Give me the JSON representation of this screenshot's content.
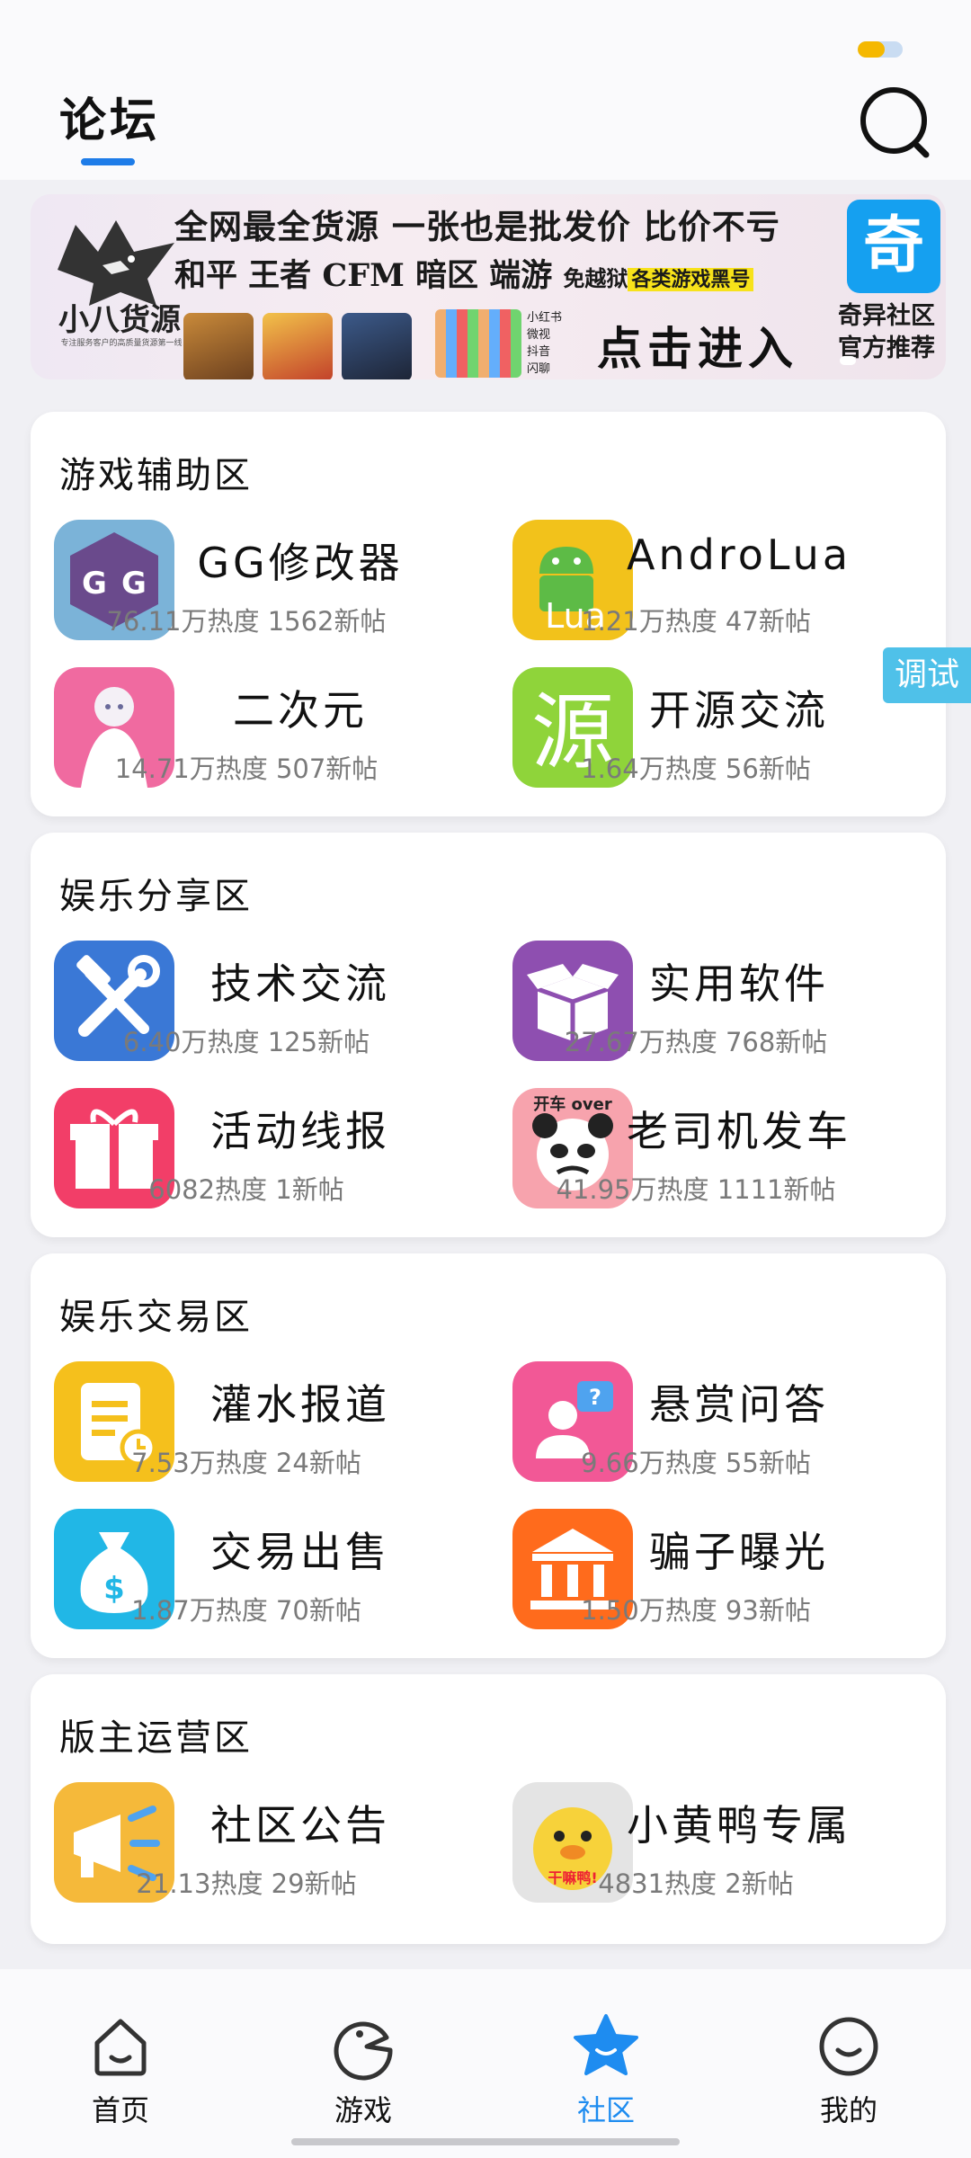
{
  "header": {
    "title": "论坛"
  },
  "status": {
    "battery_level": 0.6
  },
  "banner": {
    "shop_name": "小八货源",
    "shop_sub": "专注服务客户的高质量货源第一线",
    "line1": "全网最全货源 一张也是批发价 比价不亏",
    "line2": "和平 王者 CFM 暗区 端游",
    "line2_small": "免越狱",
    "highlight": "各类游戏黑号",
    "mini_list": [
      "小红书",
      "微视",
      "抖音",
      "闪聊"
    ],
    "enter": "点击进入",
    "badge": "奇",
    "recommend": [
      "奇异社区",
      "官方推荐"
    ]
  },
  "debug_tab": "调试",
  "sections": [
    {
      "title": "游戏辅助区",
      "items": [
        {
          "name": "GG修改器",
          "stats": "76.11万热度 1562新帖",
          "icon": "gg-modifier-icon"
        },
        {
          "name": "AndroLua",
          "stats": "1.21万热度 47新帖",
          "icon": "androlua-icon"
        },
        {
          "name": "二次元",
          "stats": "14.71万热度 507新帖",
          "icon": "anime-girl-icon"
        },
        {
          "name": "开源交流",
          "stats": "1.64万热度 56新帖",
          "icon": "source-char-icon"
        }
      ]
    },
    {
      "title": "娱乐分享区",
      "items": [
        {
          "name": "技术交流",
          "stats": "6.40万热度 125新帖",
          "icon": "tools-icon"
        },
        {
          "name": "实用软件",
          "stats": "27.67万热度 768新帖",
          "icon": "box-icon"
        },
        {
          "name": "活动线报",
          "stats": "6082热度 1新帖",
          "icon": "gift-icon"
        },
        {
          "name": "老司机发车",
          "stats": "41.95万热度 1111新帖",
          "icon": "panda-meme-icon"
        }
      ]
    },
    {
      "title": "娱乐交易区",
      "items": [
        {
          "name": "灌水报道",
          "stats": "7.53万热度 24新帖",
          "icon": "note-clock-icon"
        },
        {
          "name": "悬赏问答",
          "stats": "9.66万热度 55新帖",
          "icon": "user-question-icon"
        },
        {
          "name": "交易出售",
          "stats": "1.87万热度 70新帖",
          "icon": "money-bag-icon"
        },
        {
          "name": "骗子曝光",
          "stats": "1.50万热度 93新帖",
          "icon": "courthouse-icon"
        }
      ]
    },
    {
      "title": "版主运营区",
      "items": [
        {
          "name": "社区公告",
          "stats": "21.13热度 29新帖",
          "icon": "megaphone-icon"
        },
        {
          "name": "小黄鸭专属",
          "stats": "4831热度 2新帖",
          "icon": "yellow-duck-icon"
        }
      ]
    }
  ],
  "nav": [
    {
      "label": "首页",
      "icon": "home-icon",
      "active": false
    },
    {
      "label": "游戏",
      "icon": "game-icon",
      "active": false
    },
    {
      "label": "社区",
      "icon": "community-star-icon",
      "active": true
    },
    {
      "label": "我的",
      "icon": "profile-smile-icon",
      "active": false
    }
  ],
  "colors": {
    "accent": "#1e8cf0",
    "debug": "#4fc1e9",
    "underline": "#1e7ce8"
  }
}
